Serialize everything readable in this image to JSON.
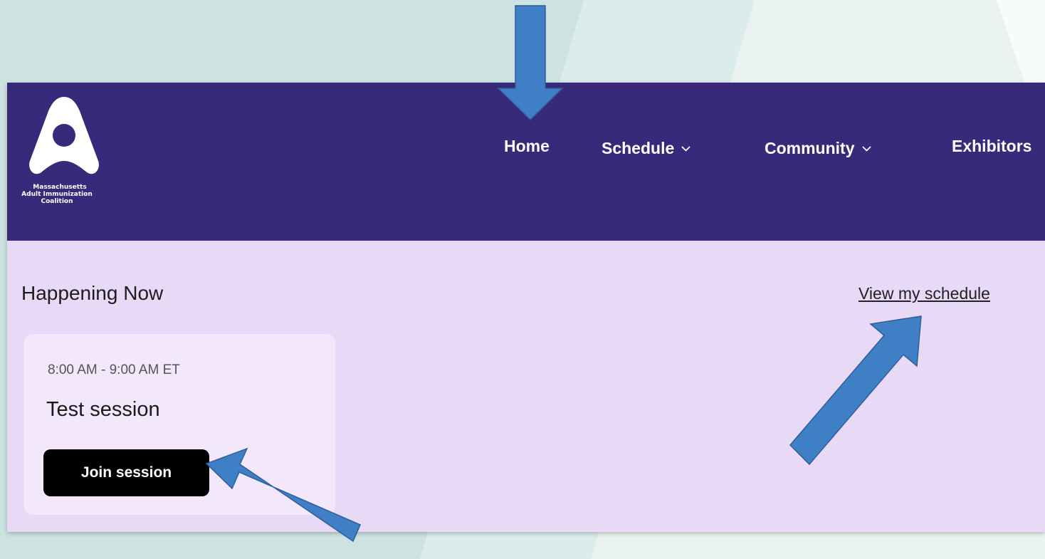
{
  "logo": {
    "line1": "Massachusetts",
    "line2": "Adult Immunization",
    "line3": "Coalition"
  },
  "nav": {
    "items": [
      {
        "label": "Home",
        "has_dropdown": false
      },
      {
        "label": "Schedule",
        "has_dropdown": true
      },
      {
        "label": "Community",
        "has_dropdown": true
      },
      {
        "label": "Exhibitors",
        "has_dropdown": false
      }
    ],
    "dropdown_icon": "chevron-down-icon"
  },
  "happening_now": {
    "heading": "Happening Now",
    "view_schedule_link": "View my schedule",
    "session": {
      "time": "8:00 AM - 9:00 AM ET",
      "title": "Test session",
      "join_label": "Join session"
    }
  },
  "colors": {
    "nav_background": "#38297b",
    "content_background": "#e8d9f6",
    "card_background": "#f2e7fb",
    "button_background": "#000000",
    "annotation_arrow": "#3f7fc6"
  }
}
